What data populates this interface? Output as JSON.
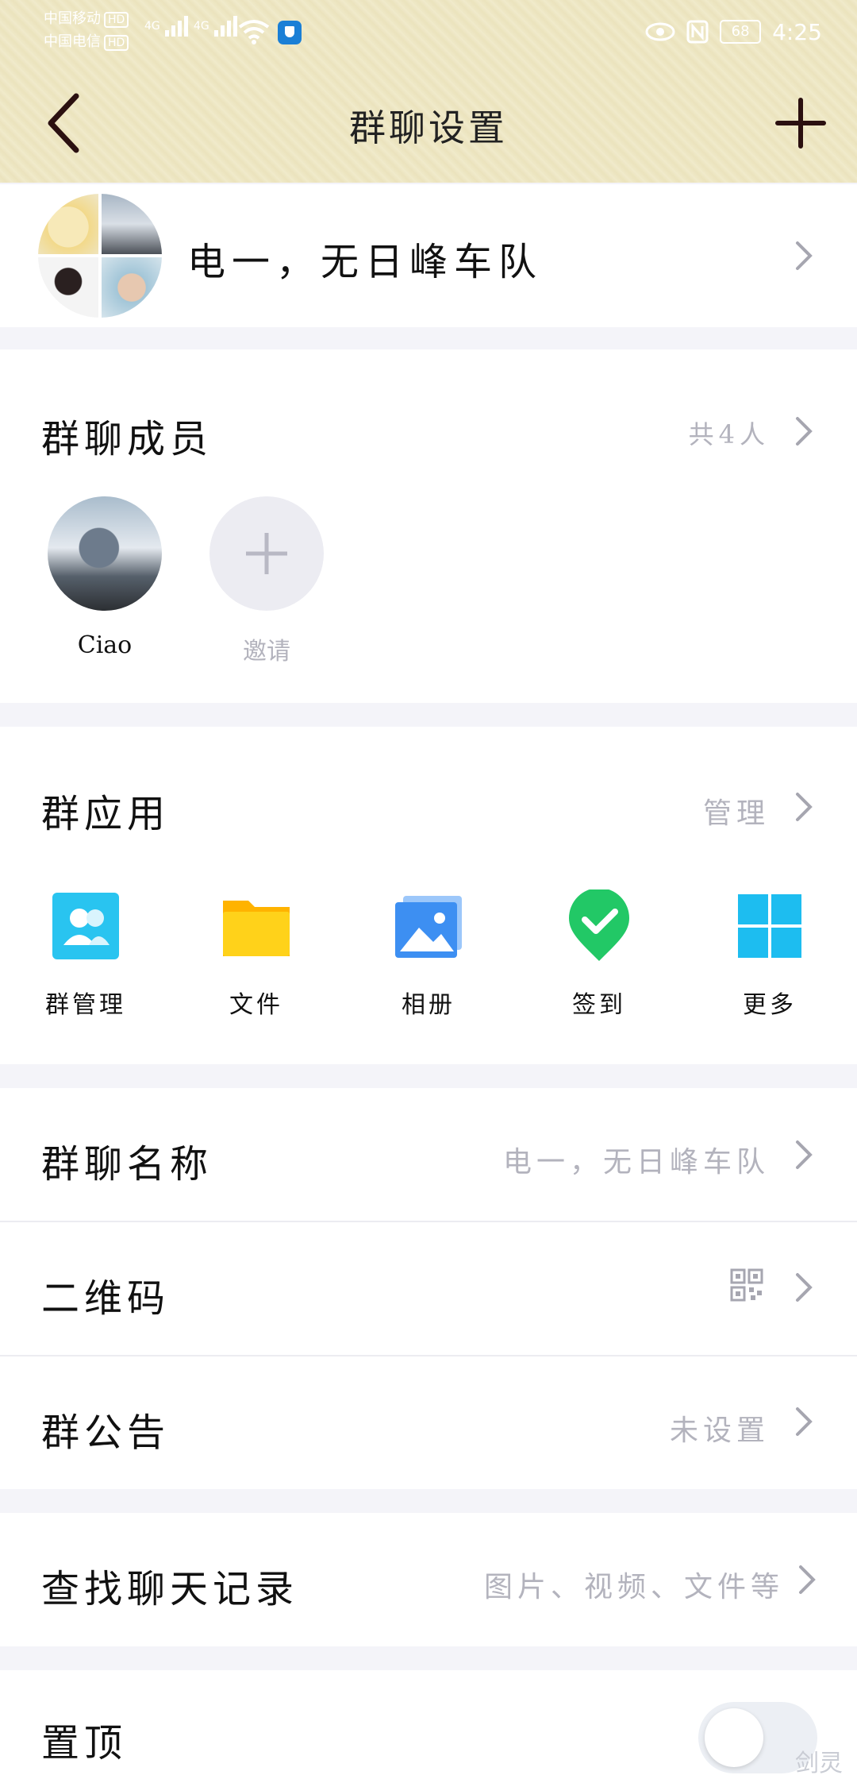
{
  "status_bar": {
    "carrier_1": "中国移动",
    "carrier_2": "中国电信",
    "hd": "HD",
    "net_1": "4G",
    "net_2": "4G",
    "battery": "68",
    "time": "4:25"
  },
  "nav": {
    "title": "群聊设置"
  },
  "group": {
    "name": "电一，无日峰车队"
  },
  "members": {
    "title": "群聊成员",
    "count": "共4人",
    "list": [
      {
        "name": "Ciao"
      },
      {
        "name": "邀请"
      }
    ]
  },
  "apps": {
    "title": "群应用",
    "manage": "管理",
    "items": [
      {
        "label": "群管理",
        "icon": "group-manage-icon",
        "color": "#29c4f0"
      },
      {
        "label": "文件",
        "icon": "folder-icon",
        "color": "#ffc40c"
      },
      {
        "label": "相册",
        "icon": "photo-album-icon",
        "color": "#3d8ff2"
      },
      {
        "label": "签到",
        "icon": "check-in-icon",
        "color": "#22c866"
      },
      {
        "label": "更多",
        "icon": "more-grid-icon",
        "color": "#1dbdf0"
      }
    ]
  },
  "settings": {
    "group_name_label": "群聊名称",
    "group_name_value": "电一，无日峰车队",
    "qr_label": "二维码",
    "announcement_label": "群公告",
    "announcement_value": "未设置",
    "search_label": "查找聊天记录",
    "search_value": "图片、视频、文件等",
    "pin_label": "置顶",
    "pin_on": false
  },
  "watermark": "剑灵"
}
